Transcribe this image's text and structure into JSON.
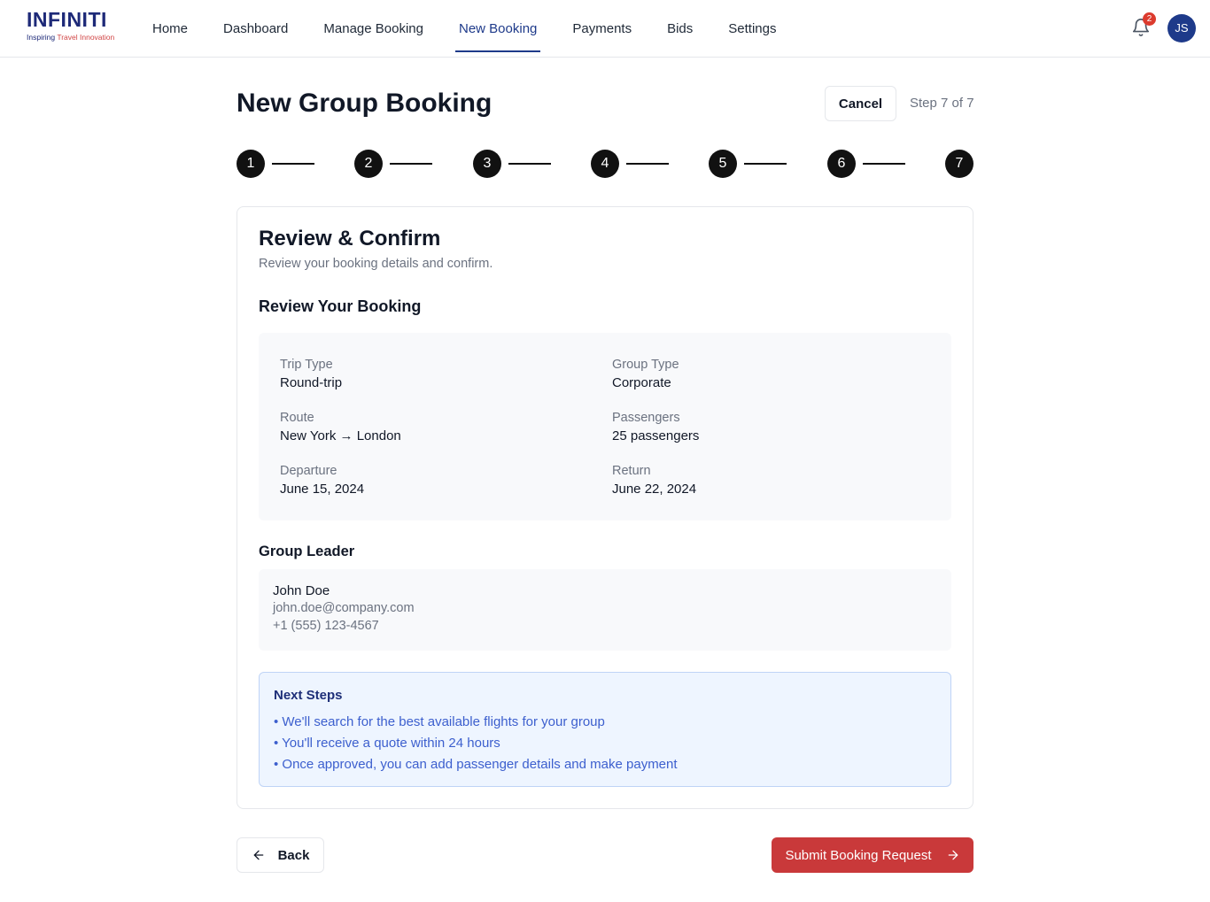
{
  "brand": {
    "name": "INFINITI",
    "tagline_prefix": "Inspiring ",
    "tagline_accent": "Travel Innovation",
    "primary_color": "#1e2a78",
    "accent_color": "#d14545"
  },
  "nav": {
    "items": [
      {
        "label": "Home"
      },
      {
        "label": "Dashboard"
      },
      {
        "label": "Manage Booking"
      },
      {
        "label": "New Booking",
        "active": true
      },
      {
        "label": "Payments"
      },
      {
        "label": "Bids"
      },
      {
        "label": "Settings"
      }
    ]
  },
  "header": {
    "notification_count": "2",
    "user_initials": "JS",
    "icons": [
      "bell-icon"
    ]
  },
  "page": {
    "title": "New Group Booking",
    "cancel_label": "Cancel",
    "step_text": "Step 7 of 7"
  },
  "stepper": {
    "steps": [
      "1",
      "2",
      "3",
      "4",
      "5",
      "6",
      "7"
    ],
    "current": 7,
    "completed_color": "#111111"
  },
  "review": {
    "title": "Review & Confirm",
    "subtitle": "Review your booking details and confirm.",
    "section_title": "Review Your Booking",
    "fields": {
      "trip_type": {
        "label": "Trip Type",
        "value": "Round-trip"
      },
      "group_type": {
        "label": "Group Type",
        "value": "Corporate"
      },
      "route": {
        "label": "Route",
        "value": "New York → London"
      },
      "passengers": {
        "label": "Passengers",
        "value": "25 passengers"
      },
      "departure": {
        "label": "Departure",
        "value": "June 15, 2024"
      },
      "return": {
        "label": "Return",
        "value": "June 22, 2024"
      }
    }
  },
  "leader": {
    "title": "Group Leader",
    "name": "John Doe",
    "email": "john.doe@company.com",
    "phone": "+1 (555) 123-4567"
  },
  "next_steps": {
    "title": "Next Steps",
    "items": [
      "• We'll search for the best available flights for your group",
      "• You'll receive a quote within 24 hours",
      "• Once approved, you can add passenger details and make payment"
    ]
  },
  "actions": {
    "back_label": "Back",
    "submit_label": "Submit Booking Request",
    "submit_color": "#c9393a",
    "icons": [
      "arrow-left-icon",
      "arrow-right-icon"
    ]
  }
}
